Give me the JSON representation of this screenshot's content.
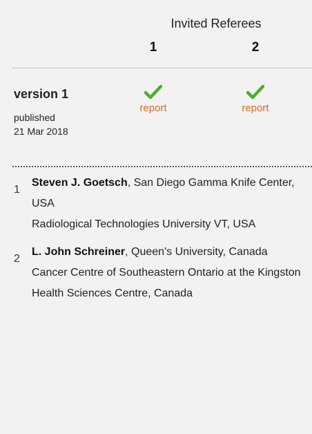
{
  "header": {
    "title": "Invited Referees",
    "columns": [
      "1",
      "2"
    ]
  },
  "version": {
    "label": "version 1",
    "status": "published",
    "date": "21 Mar 2018",
    "reports": [
      {
        "approved": true,
        "link_label": "report"
      },
      {
        "approved": true,
        "link_label": "report"
      }
    ]
  },
  "referees": [
    {
      "number": "1",
      "name": "Steven J. Goetsch",
      "affiliation_1": ", San Diego Gamma Knife Center, USA",
      "affiliation_2": "Radiological Technologies University VT, USA"
    },
    {
      "number": "2",
      "name": "L. John Schreiner",
      "affiliation_1": ", Queen's University, Canada",
      "affiliation_2": "Cancer Centre of Southeastern Ontario at the Kingston Health Sciences Centre, Canada"
    }
  ],
  "colors": {
    "check": "#4caf2a",
    "link": "#d86a22",
    "background": "#f2f2f2"
  },
  "icons": {
    "approved": "check-icon"
  }
}
